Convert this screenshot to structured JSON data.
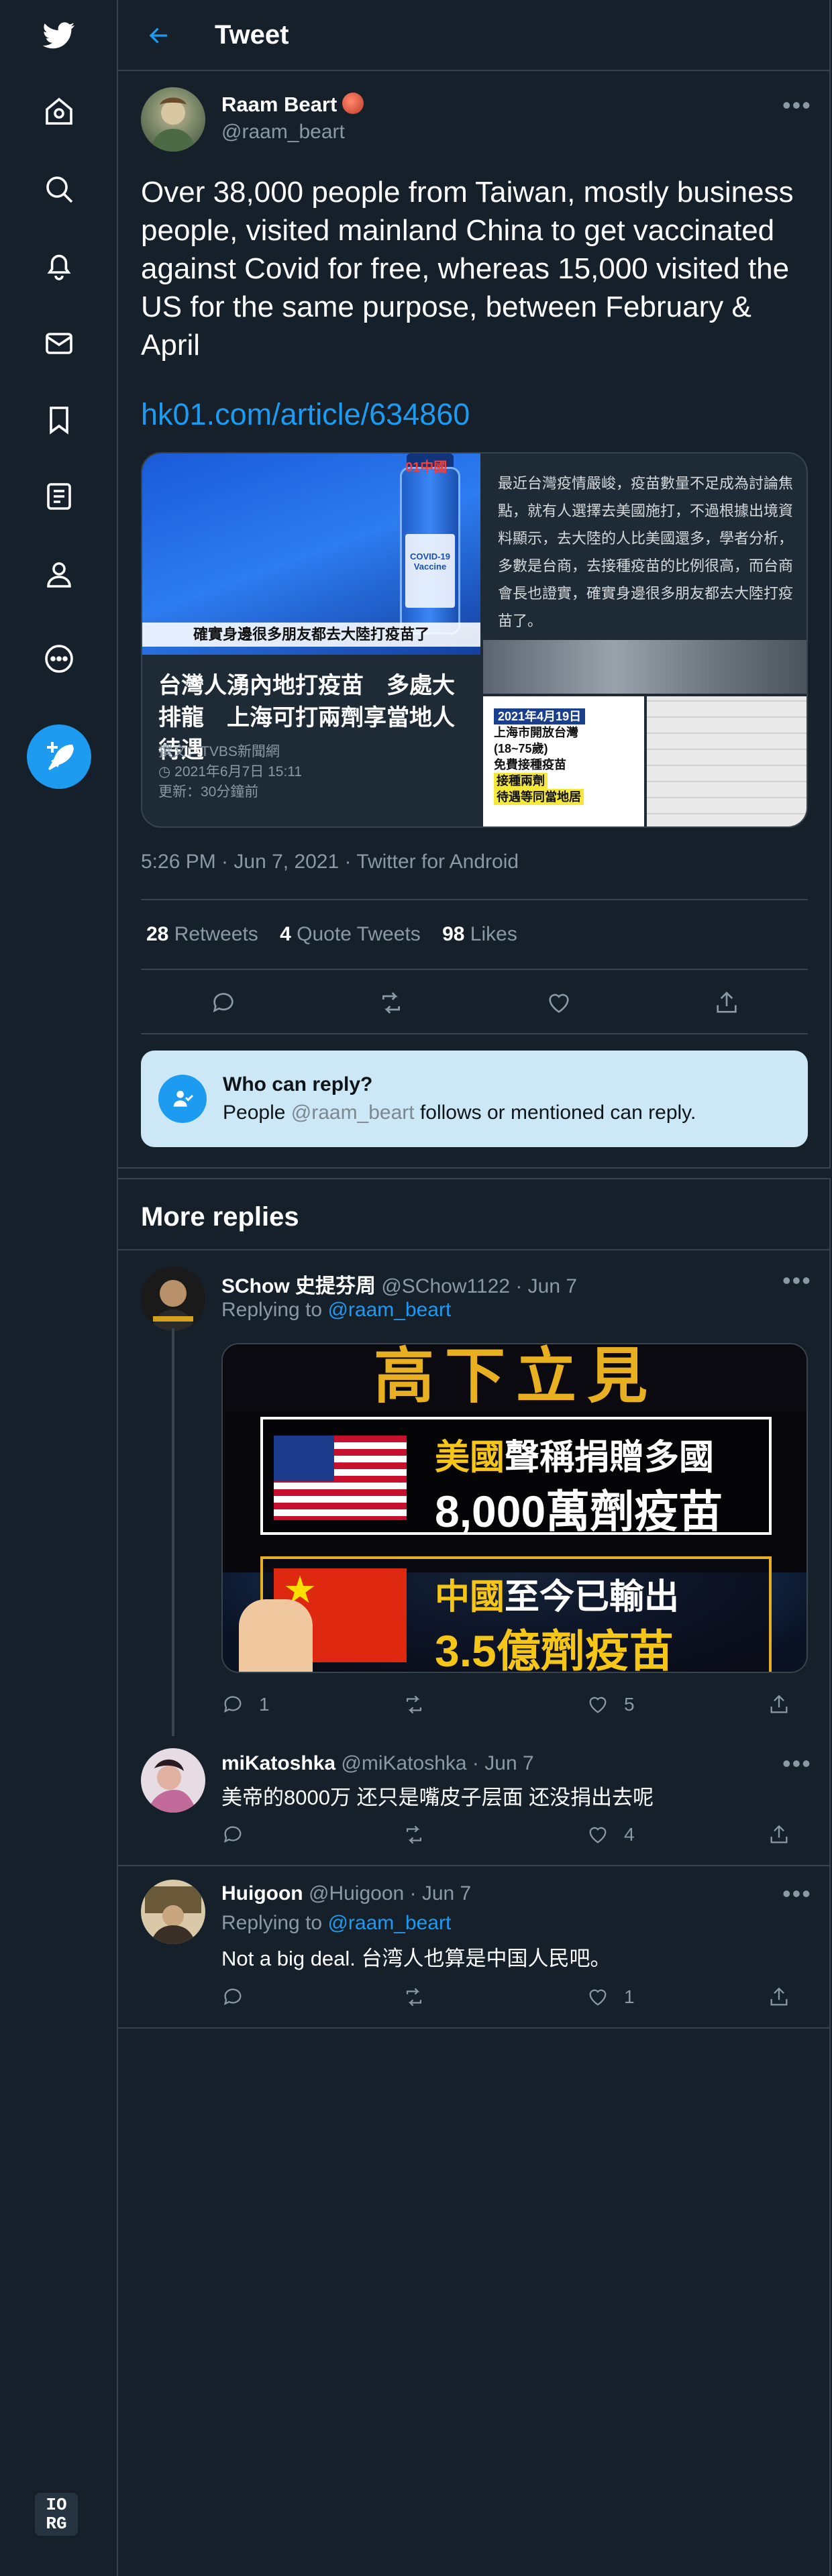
{
  "header": {
    "title": "Tweet"
  },
  "tweet": {
    "author_name": "Raam Beart",
    "author_handle": "@raam_beart",
    "text": "Over 38,000 people from Taiwan, mostly business people, visited mainland China to get vaccinated against Covid for free, whereas 15,000 visited the US for the same purpose, between February & April",
    "link": "hk01.com/article/634860",
    "card": {
      "image_caption": "確實身邊很多朋友都去大陸打疫苗了",
      "image_tag": "01中國",
      "vial_label": "COVID-19 Vaccine",
      "title": "台灣人湧內地打疫苗　多處大排龍　上海可打兩劑享當地人待遇",
      "byline": "撰文：TVBS新聞網",
      "date": "2021年6月7日 15:11",
      "updated": "更新：30分鐘前",
      "snippet": "最近台灣疫情嚴峻，疫苗數量不足成為討論焦點，就有人選擇去美國施打，不過根據出境資料顯示，去大陸的人比美國還多，學者分析，多數是台商，去接種疫苗的比例很高，而台商會長也證實，確實身邊很多朋友都去大陸打疫苗了。",
      "photo_date": "2021年4月19日",
      "photo_line1": "上海市開放台灣",
      "photo_line2": "(18~75歲)",
      "photo_line3": "免費接種疫苗",
      "photo_line4": "接種兩劑",
      "photo_line5": "待遇等同當地居"
    },
    "meta": "5:26 PM · Jun 7, 2021 · Twitter for Android",
    "retweets": "28",
    "retweets_label": "Retweets",
    "quotes": "4",
    "quotes_label": "Quote Tweets",
    "likes": "98",
    "likes_label": "Likes"
  },
  "who_can_reply": {
    "title": "Who can reply?",
    "text_before": "People ",
    "handle": "@raam_beart",
    "text_after": " follows or mentioned can reply."
  },
  "more_replies": "More replies",
  "replies": [
    {
      "name": "SChow 史提芬周",
      "handle": "@SChow1122 · Jun 7",
      "replying_label": "Replying to ",
      "replying_to": "@raam_beart",
      "media": {
        "top": "高下立見",
        "us_1": "美國",
        "us_2": "聲稱捐贈多國",
        "us_3": "8,000萬劑疫苗",
        "cn_1": "中國",
        "cn_2": "至今已輸出",
        "cn_3": "3.5億劑疫苗"
      },
      "replies_count": "1",
      "retweets_count": "",
      "likes_count": "5"
    },
    {
      "name": "miKatoshka",
      "handle": "@miKatoshka · Jun 7",
      "text": "美帝的8000万 还只是嘴皮子层面 还没捐出去呢",
      "replies_count": "",
      "retweets_count": "",
      "likes_count": "4"
    },
    {
      "name": "Huigoon",
      "handle": "@Huigoon · Jun 7",
      "replying_label": "Replying to ",
      "replying_to": "@raam_beart",
      "text": "Not a big deal. 台湾人也算是中国人民吧。",
      "replies_count": "",
      "retweets_count": "",
      "likes_count": "1"
    }
  ],
  "footer_logo": {
    "line1": "IO",
    "line2": "RG"
  },
  "colors": {
    "background": "#15202b",
    "accent": "#1d9bf0",
    "muted": "#8b98a5",
    "border": "#38444d",
    "notice": "#cce7f5"
  },
  "icons": [
    "twitter-logo-icon",
    "home-icon",
    "search-icon",
    "notifications-icon",
    "messages-icon",
    "bookmarks-icon",
    "lists-icon",
    "profile-icon",
    "more-icon",
    "compose-icon",
    "back-arrow-icon",
    "reply-icon",
    "retweet-icon",
    "like-icon",
    "share-icon",
    "people-icon"
  ]
}
